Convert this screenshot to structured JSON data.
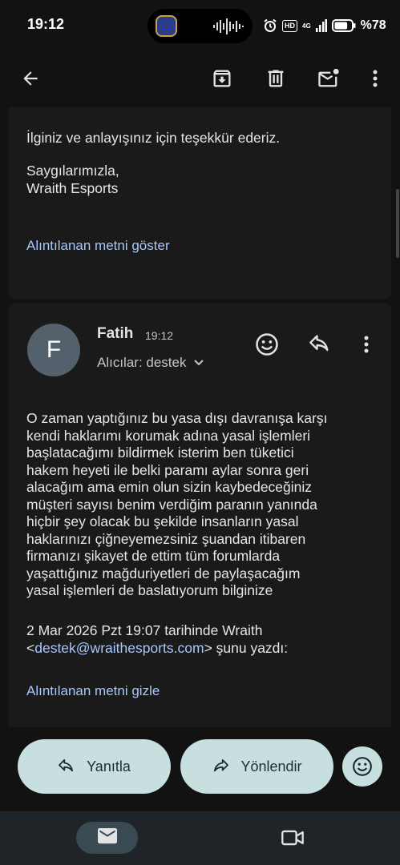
{
  "status_bar": {
    "time": "19:12",
    "hd_badge": "HD",
    "network": "4G",
    "battery_percent_text": "%78",
    "battery_level": 0.78
  },
  "app_bar": {
    "icons": [
      "back-arrow-icon",
      "archive-icon",
      "delete-icon",
      "mark-unread-icon",
      "more-vert-icon"
    ]
  },
  "previous_message": {
    "thanks_line": "İlginiz ve anlayışınız için teşekkür ederiz.",
    "signoff": "Saygılarımızla,",
    "signature": "Wraith Esports",
    "show_quoted": "Alıntılanan metni göster"
  },
  "message": {
    "avatar_letter": "F",
    "sender": "Fatih",
    "time": "19:12",
    "recipients": "Alıcılar: destek",
    "body_lines": [
      "O zaman yaptığınız bu yasa dışı davranışa karşı",
      "kendi haklarımı korumak adına yasal işlemleri",
      "başlatacağımı bildirmek isterim ben tüketici",
      "hakem heyeti ile belki paramı aylar sonra geri",
      "alacağım ama emin olun sizin kaybedeceğiniz",
      "müşteri sayısı benim verdiğim paranın yanında",
      "hiçbir şey olacak bu şekilde insanların yasal",
      "haklarınızı çiğneyemezsiniz şuandan itibaren",
      "firmanızı şikayet de ettim tüm forumlarda",
      "yaşattığınız mağduriyetleri de paylaşacağım",
      "yasal işlemleri de baslatıyorum bilginize"
    ],
    "quote_header_line1": "2 Mar 2026 Pzt 19:07 tarihinde Wraith",
    "quote_header_open": "<",
    "quote_email": "destek@wraithesports.com",
    "quote_header_close": "> şunu yazdı:",
    "hide_quoted": "Alıntılanan metni gizle"
  },
  "actions": {
    "reply_label": "Yanıtla",
    "forward_label": "Yönlendir"
  },
  "colors": {
    "background": "#121212",
    "card": "#1a1a1a",
    "link": "#a8c7fa",
    "button": "#c8dfe0",
    "avatar": "#54606b"
  }
}
